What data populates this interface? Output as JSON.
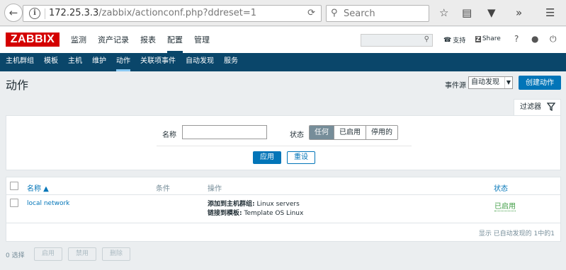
{
  "browser": {
    "url_host": "172.25.3.3",
    "url_path": "/zabbix/actionconf.php?ddreset=1",
    "search_placeholder": "Search"
  },
  "header": {
    "logo": "ZABBIX",
    "menu": [
      "监测",
      "资产记录",
      "报表",
      "配置",
      "管理"
    ],
    "active_menu": "配置",
    "support": "支持",
    "share": "Share",
    "help": "?"
  },
  "subnav": {
    "items": [
      "主机群组",
      "模板",
      "主机",
      "维护",
      "动作",
      "关联项事件",
      "自动发现",
      "服务"
    ],
    "active": "动作"
  },
  "page": {
    "title": "动作",
    "event_source_label": "事件源",
    "event_source_value": "自动发现",
    "create_button": "创建动作"
  },
  "filter": {
    "tab_label": "过滤器",
    "name_label": "名称",
    "name_value": "",
    "status_label": "状态",
    "status_options": [
      "任何",
      "已启用",
      "停用的"
    ],
    "status_selected": "任何",
    "apply_button": "应用",
    "reset_button": "重设"
  },
  "table": {
    "headers": {
      "name": "名称 ▲",
      "conditions": "条件",
      "operations": "操作",
      "status": "状态"
    },
    "rows": [
      {
        "name": "local network",
        "conditions": "",
        "op1_label": "添加到主机群组:",
        "op1_value": " Linux servers",
        "op2_label": "链接到模板:",
        "op2_value": " Template OS Linux",
        "status": "已启用"
      }
    ],
    "footer": "显示 已自动发现的 1中的1"
  },
  "mass_actions": {
    "selected": "0 选择",
    "enable": "启用",
    "disable": "禁用",
    "delete": "删除"
  },
  "colors": {
    "brand": "#d40000",
    "nav": "#0a466a",
    "accent": "#0275b8",
    "enabled": "#429e47"
  }
}
